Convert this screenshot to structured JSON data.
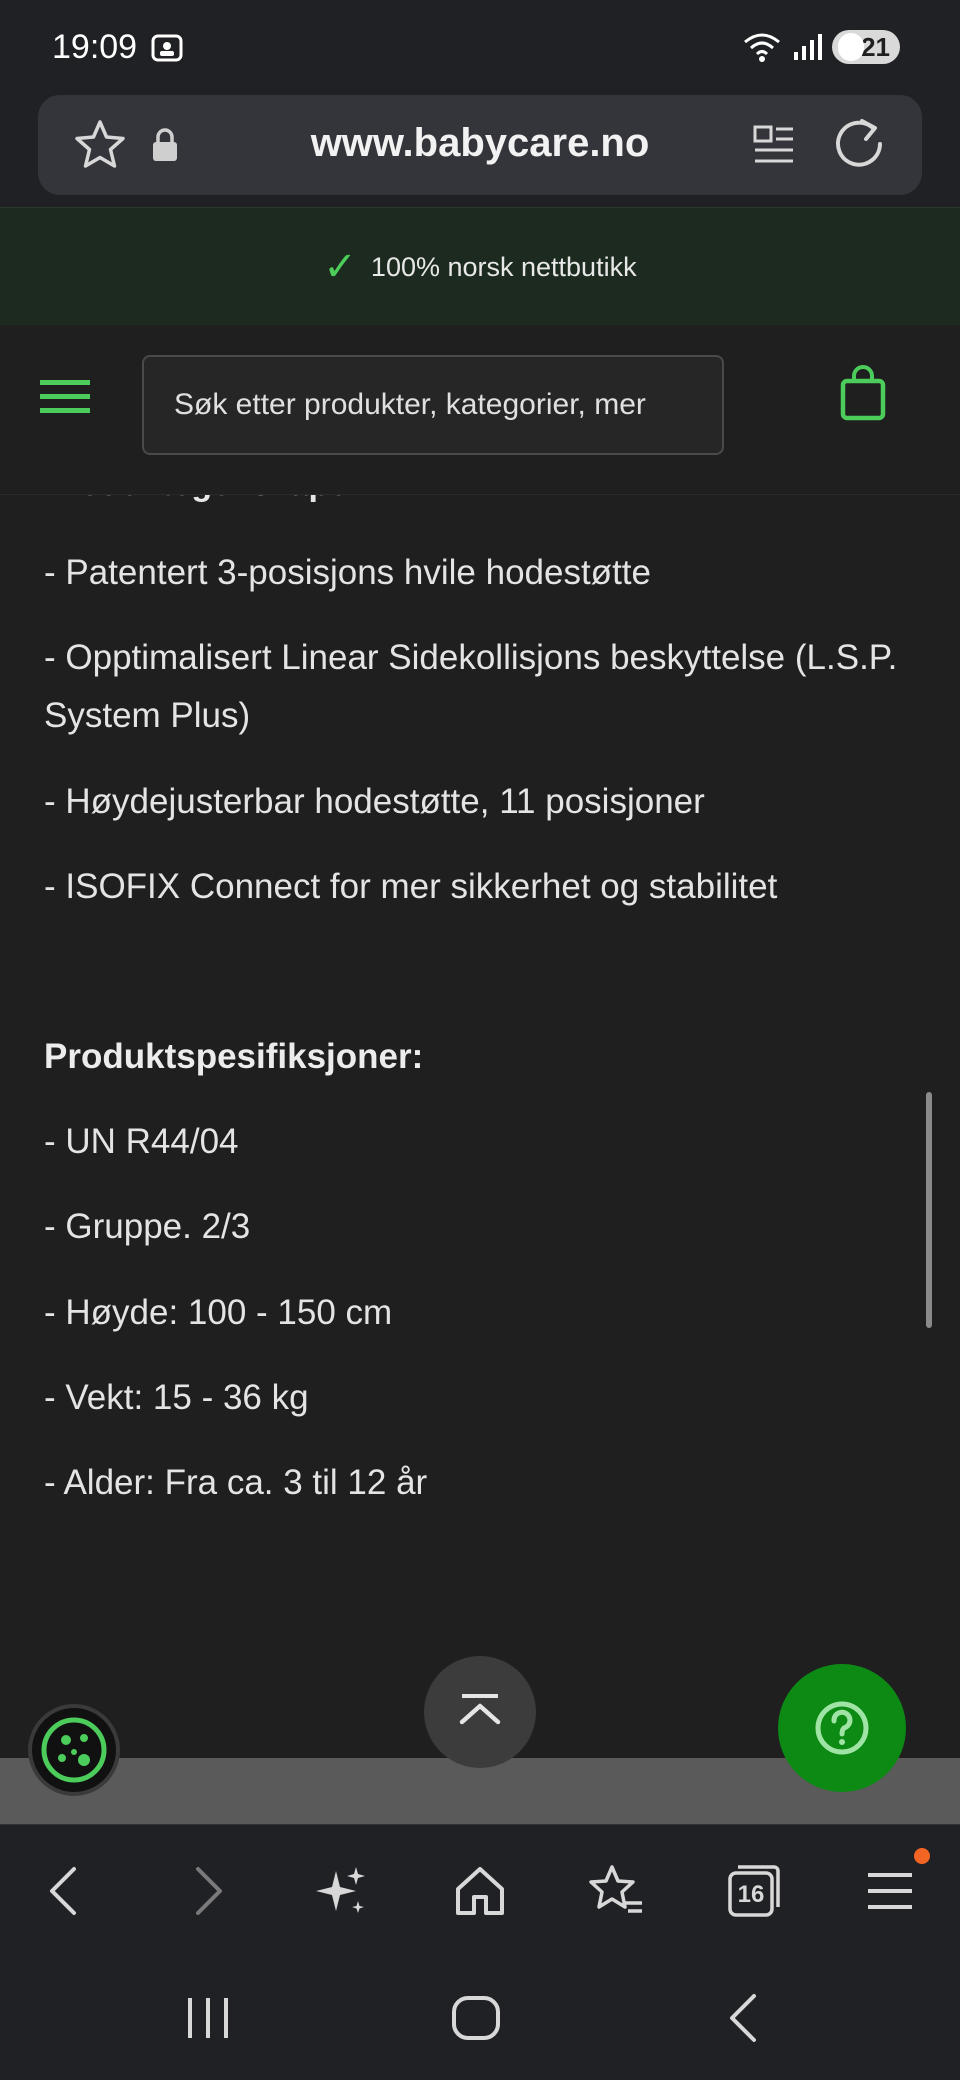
{
  "status_bar": {
    "time": "19:09",
    "battery": "21"
  },
  "browser": {
    "url": "www.babycare.no",
    "tab_count": "16"
  },
  "banner": {
    "check": "✓",
    "text": "100% norsk nettbutikk"
  },
  "header": {
    "search_placeholder": "Søk etter produkter, kategorier, mer"
  },
  "content": {
    "partial_heading": "Produktegenskaper:",
    "features": [
      "- Patentert 3-posisjons hvile hodestøtte",
      "- Opptimalisert Linear Sidekollisjons beskyttelse (L.S.P. System Plus)",
      "- Høydejusterbar hodestøtte, 11 posisjoner",
      "- ISOFIX Connect for mer sikkerhet og stabilitet"
    ],
    "specs_heading": "Produktspesifiksjoner:",
    "specs": [
      "- UN R44/04",
      "- Gruppe. 2/3",
      "- Høyde: 100 - 150 cm",
      "- Vekt: 15 - 36 kg",
      "- Alder: Fra ca. 3 til 12 år"
    ]
  },
  "colors": {
    "accent_green": "#4ccc5a",
    "help_button": "#0c8a14",
    "notification": "#f26522"
  }
}
